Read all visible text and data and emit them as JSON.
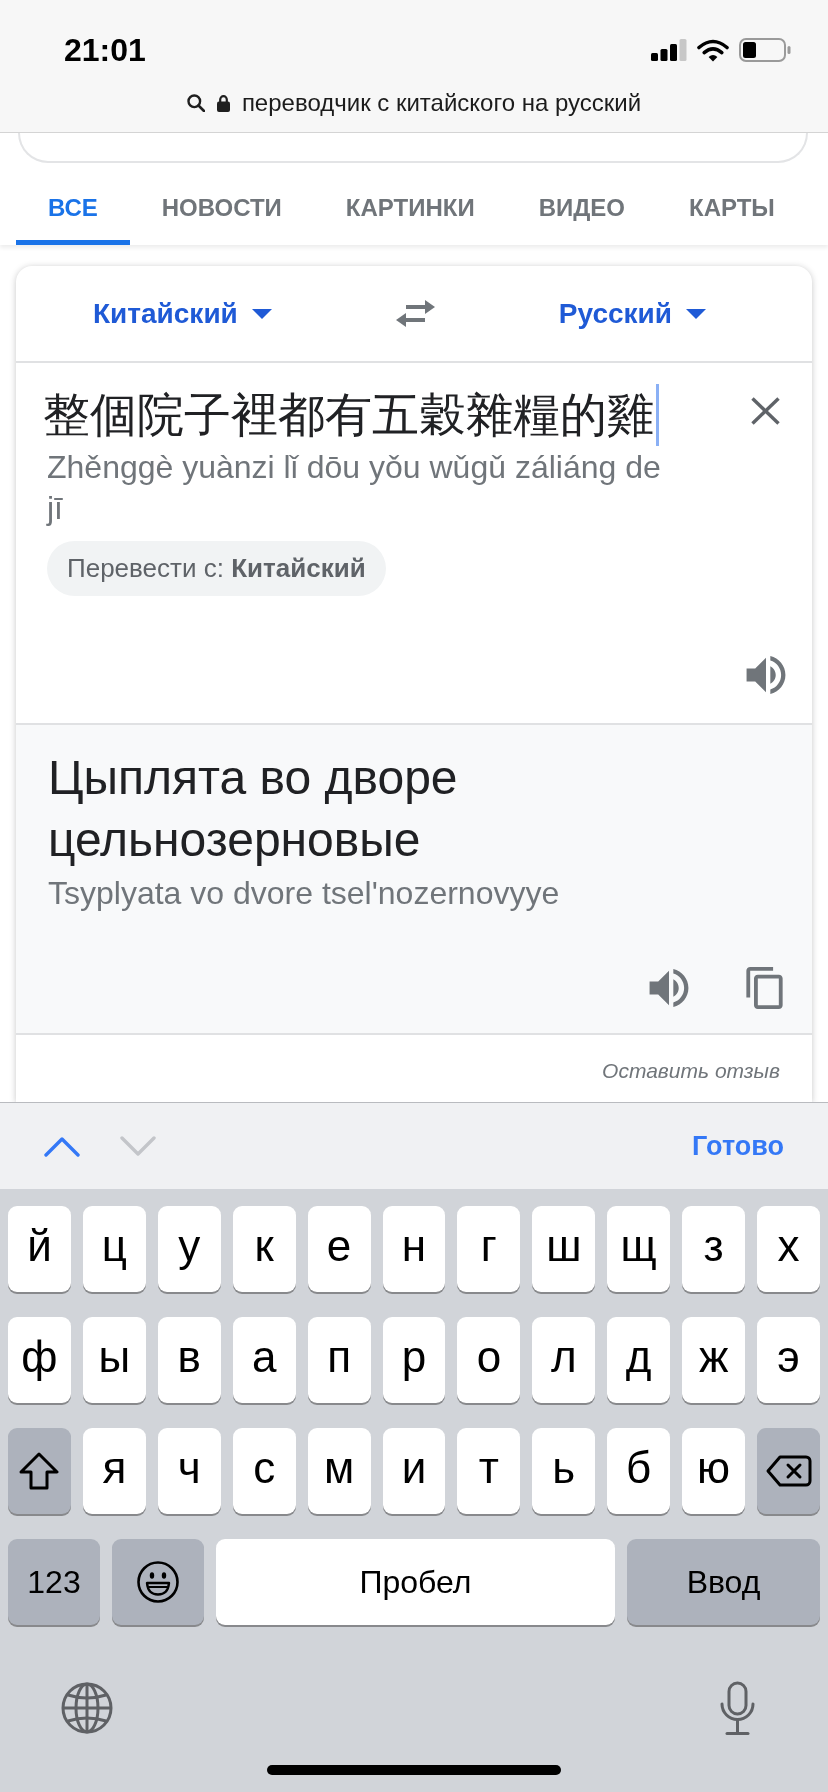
{
  "status_bar": {
    "time": "21:01"
  },
  "address_bar": {
    "text": "переводчик с китайского на русский"
  },
  "tabs": [
    {
      "label": "ВСЕ",
      "selected": true
    },
    {
      "label": "НОВОСТИ",
      "selected": false
    },
    {
      "label": "КАРТИНКИ",
      "selected": false
    },
    {
      "label": "ВИДЕО",
      "selected": false
    },
    {
      "label": "КАРТЫ",
      "selected": false
    }
  ],
  "translator": {
    "source_language": "Китайский",
    "target_language": "Русский",
    "source_text": "整個院子裡都有五穀雜糧的雞",
    "source_romanization": "Zhěnggè yuànzi lǐ dōu yǒu wǔgǔ záliáng de jī",
    "detected_language": "Перевести с: **Китайский**",
    "translation": "Цыплята во дворе цельнозерновые",
    "translation_romanization": "Tsyplyata vo dvore tsel'nozernovyye",
    "feedback_link": "Оставить отзыв"
  },
  "keyboard": {
    "toolbar": {
      "nav": [
        {
          "kind": "previous",
          "disabled": false
        },
        {
          "kind": "next",
          "disabled": true
        }
      ],
      "done": "Готово"
    },
    "rows": [
      [
        {
          "kind": "letter",
          "label": "й"
        },
        {
          "kind": "letter",
          "label": "ц"
        },
        {
          "kind": "letter",
          "label": "у"
        },
        {
          "kind": "letter",
          "label": "к"
        },
        {
          "kind": "letter",
          "label": "е"
        },
        {
          "kind": "letter",
          "label": "н"
        },
        {
          "kind": "letter",
          "label": "г"
        },
        {
          "kind": "letter",
          "label": "ш"
        },
        {
          "kind": "letter",
          "label": "щ"
        },
        {
          "kind": "letter",
          "label": "з"
        },
        {
          "kind": "letter",
          "label": "х"
        }
      ],
      [
        {
          "kind": "letter",
          "label": "ф"
        },
        {
          "kind": "letter",
          "label": "ы"
        },
        {
          "kind": "letter",
          "label": "в"
        },
        {
          "kind": "letter",
          "label": "а"
        },
        {
          "kind": "letter",
          "label": "п"
        },
        {
          "kind": "letter",
          "label": "р"
        },
        {
          "kind": "letter",
          "label": "о"
        },
        {
          "kind": "letter",
          "label": "л"
        },
        {
          "kind": "letter",
          "label": "д"
        },
        {
          "kind": "letter",
          "label": "ж"
        },
        {
          "kind": "letter",
          "label": "э"
        }
      ],
      [
        {
          "kind": "shift"
        },
        {
          "kind": "letter",
          "label": "я"
        },
        {
          "kind": "letter",
          "label": "ч"
        },
        {
          "kind": "letter",
          "label": "с"
        },
        {
          "kind": "letter",
          "label": "м"
        },
        {
          "kind": "letter",
          "label": "и"
        },
        {
          "kind": "letter",
          "label": "т"
        },
        {
          "kind": "letter",
          "label": "ь"
        },
        {
          "kind": "letter",
          "label": "б"
        },
        {
          "kind": "letter",
          "label": "ю"
        },
        {
          "kind": "delete"
        }
      ]
    ],
    "bottom_row": [
      {
        "kind": "numbers",
        "label": "123"
      },
      {
        "kind": "emoji"
      },
      {
        "kind": "space",
        "label": "Пробел"
      },
      {
        "kind": "return",
        "label": "Ввод"
      }
    ]
  }
}
